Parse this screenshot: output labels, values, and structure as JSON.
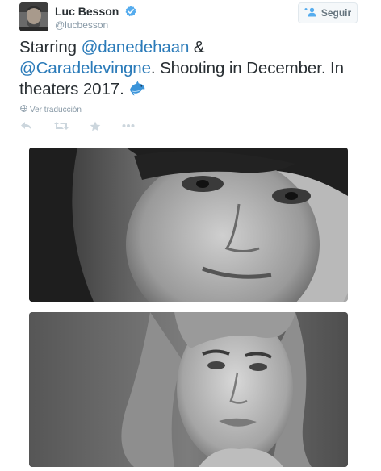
{
  "user": {
    "name": "Luc Besson",
    "handle": "@lucbesson",
    "verified_color": "#55acee"
  },
  "follow": {
    "label": "Seguir",
    "icon": "add-person-icon"
  },
  "tweet": {
    "part1": "Starring ",
    "mention1": "@danedehaan",
    "part2": " &",
    "mention2": "@Caradelevingne",
    "part3": ". Shooting in December. In theaters 2017.",
    "emoji": "dolphin-icon"
  },
  "translate": {
    "label": "Ver traducción",
    "icon": "globe-icon"
  },
  "actions": [
    "reply-icon",
    "retweet-icon",
    "favorite-icon",
    "more-icon"
  ],
  "media": [
    "photo-dane-dehaan",
    "photo-cara-delevingne"
  ],
  "colors": {
    "link": "#2b7bb9",
    "muted": "#8899a6",
    "text": "#292f33"
  }
}
